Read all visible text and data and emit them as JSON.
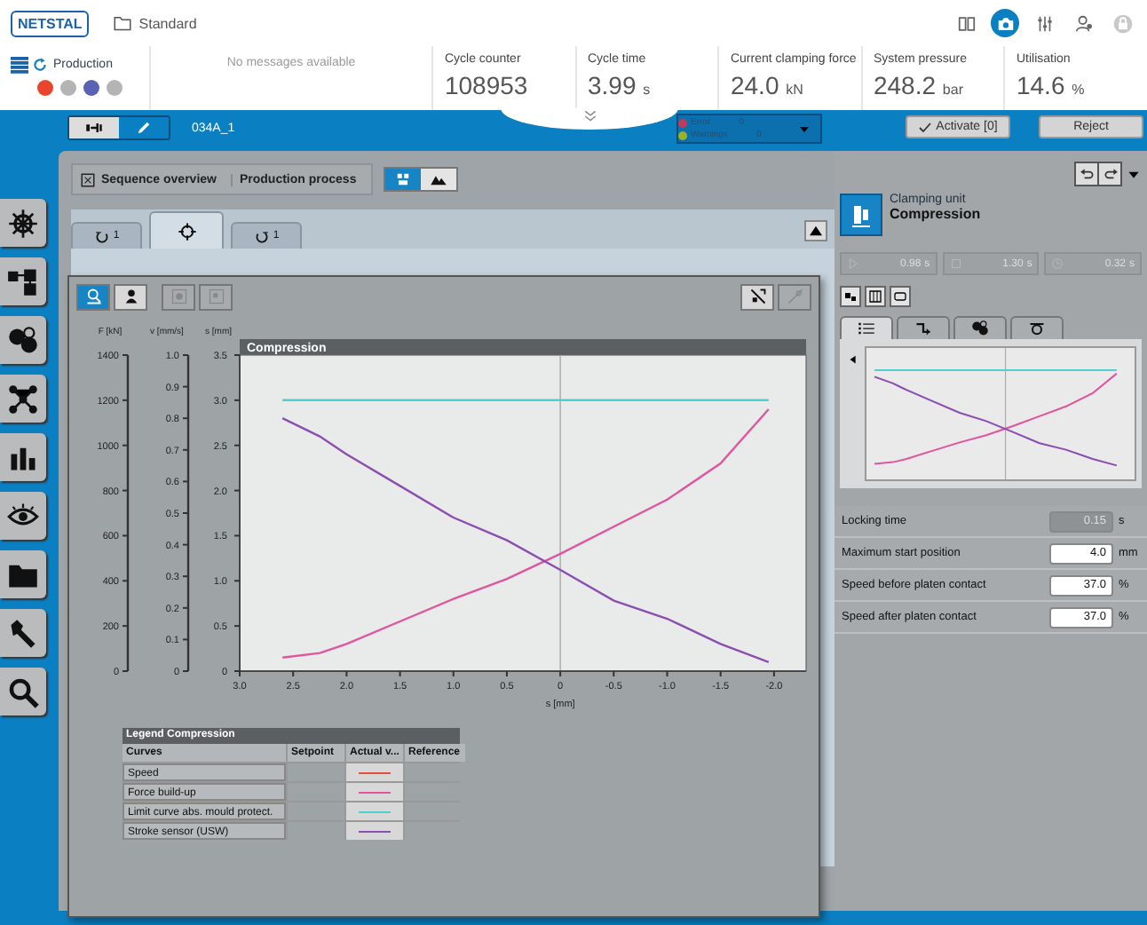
{
  "header": {
    "logo": "NETSTAL",
    "profile": "Standard",
    "top_icons": [
      {
        "kind": "book",
        "selected": false
      },
      {
        "kind": "camera",
        "selected": true
      },
      {
        "kind": "sliders",
        "selected": false
      },
      {
        "kind": "user",
        "selected": false
      },
      {
        "kind": "lock",
        "selected": false
      }
    ],
    "mode": "Production",
    "status_dots": [
      {
        "color": "#e8452c"
      },
      {
        "color": "#b4b4b4"
      },
      {
        "color": "#5a62b4"
      },
      {
        "color": "#b4b4b4"
      }
    ],
    "messages": "No messages available",
    "metrics": [
      {
        "label": "Cycle counter",
        "value": "108953"
      },
      {
        "label": "Cycle time",
        "value": "3.99",
        "unit": "s"
      },
      {
        "label": "Current clamping force",
        "value": "24.0",
        "unit": "kN"
      },
      {
        "label": "System pressure",
        "value": "248.2",
        "unit": "bar"
      },
      {
        "label": "Utilisation",
        "value": "14.6",
        "unit": "%"
      }
    ]
  },
  "toolbar": {
    "mode_toggle": [
      {
        "kind": "machine",
        "selected": false
      },
      {
        "kind": "pen",
        "selected": true
      }
    ],
    "program": "034A_1",
    "alarms": [
      {
        "kind": "error",
        "label": "Error",
        "count": "0"
      },
      {
        "kind": "warning",
        "label": "Warnings",
        "count": "0"
      }
    ],
    "buttons": [
      {
        "kind": "activate",
        "label": "Activate [0]"
      },
      {
        "kind": "reject",
        "label": "Reject"
      }
    ]
  },
  "sidebar": {
    "items": [
      {
        "kind": "wheel"
      },
      {
        "kind": "squares"
      },
      {
        "kind": "circles"
      },
      {
        "kind": "network"
      },
      {
        "kind": "bars"
      },
      {
        "kind": "eye"
      },
      {
        "kind": "folder"
      },
      {
        "kind": "wrench"
      },
      {
        "kind": "search"
      }
    ]
  },
  "main": {
    "breadcrumb": [
      "Sequence overview",
      "Production process"
    ],
    "view_toggle": [
      {
        "kind": "mold",
        "selected": true
      },
      {
        "kind": "mountains",
        "selected": false
      }
    ],
    "tabs": [
      {
        "kind": "rotate-left",
        "count": "1",
        "selected": false
      },
      {
        "kind": "target",
        "selected": true
      },
      {
        "kind": "rotate-right",
        "count": "1",
        "selected": false
      }
    ]
  },
  "chart_window": {
    "tools": [
      {
        "kind": "zoom",
        "selected": true,
        "disabled": false
      },
      {
        "kind": "person",
        "selected": false,
        "disabled": false
      },
      {
        "kind": "copy",
        "selected": false,
        "disabled": true
      },
      {
        "kind": "paste",
        "selected": false,
        "disabled": true
      }
    ],
    "right_tools": [
      {
        "kind": "cursor",
        "disabled": false
      },
      {
        "kind": "eraser",
        "disabled": true
      }
    ],
    "extra_axes": [
      {
        "label": "F [kN]",
        "ticks": [
          "1400",
          "1200",
          "1000",
          "800",
          "600",
          "400",
          "200",
          "0"
        ]
      },
      {
        "label": "v [mm/s]",
        "ticks": [
          "1.0",
          "0.9",
          "0.8",
          "0.7",
          "0.6",
          "0.5",
          "0.4",
          "0.3",
          "0.2",
          "0.1",
          "0"
        ]
      }
    ],
    "chart_data": {
      "type": "line",
      "title": "Compression",
      "xlabel": "s [mm]",
      "ylabel": "s [mm]",
      "x": [
        2.6,
        2.25,
        2.0,
        1.5,
        1.0,
        0.5,
        0.0,
        -0.5,
        -1.0,
        -1.5,
        -1.95
      ],
      "series": [
        {
          "name": "Speed",
          "color": "#e8503c",
          "values": [
            null,
            null,
            null,
            null,
            null,
            null,
            null,
            null,
            null,
            null,
            null
          ]
        },
        {
          "name": "Force build-up",
          "color": "#e0559f",
          "values": [
            0.15,
            0.2,
            0.3,
            0.55,
            0.8,
            1.02,
            1.3,
            1.6,
            1.9,
            2.3,
            2.9
          ]
        },
        {
          "name": "Limit curve abs. mould protect.",
          "color": "#4fcfcf",
          "values": [
            3.0,
            3.0,
            3.0,
            3.0,
            3.0,
            3.0,
            3.0,
            3.0,
            3.0,
            3.0,
            3.0
          ]
        },
        {
          "name": "Stroke sensor (USW)",
          "color": "#8a4fb0",
          "values": [
            2.8,
            2.6,
            2.4,
            2.05,
            1.7,
            1.45,
            1.12,
            0.78,
            0.58,
            0.3,
            0.1
          ]
        }
      ],
      "xlim": [
        3.0,
        -2.3
      ],
      "ylim": [
        0,
        3.5
      ],
      "xticks": [
        {
          "value": 3,
          "label": "3.0"
        },
        {
          "value": 2.5,
          "label": "2.5"
        },
        {
          "value": 2,
          "label": "2.0"
        },
        {
          "value": 1.5,
          "label": "1.5"
        },
        {
          "value": 1,
          "label": "1.0"
        },
        {
          "value": 0.5,
          "label": "0.5"
        },
        {
          "value": 0,
          "label": "0"
        },
        {
          "value": -0.5,
          "label": "-0.5"
        },
        {
          "value": -1,
          "label": "-1.0"
        },
        {
          "value": -1.5,
          "label": "-1.5"
        },
        {
          "value": -2,
          "label": "-2.0"
        }
      ],
      "yticks": [
        {
          "value": 0,
          "label": "0"
        },
        {
          "value": 0.5,
          "label": "0.5"
        },
        {
          "value": 1,
          "label": "1.0"
        },
        {
          "value": 1.5,
          "label": "1.5"
        },
        {
          "value": 2,
          "label": "2.0"
        },
        {
          "value": 2.5,
          "label": "2.5"
        },
        {
          "value": 3,
          "label": "3.0"
        },
        {
          "value": 3.5,
          "label": "3.5"
        }
      ]
    },
    "legend": {
      "title": "Legend Compression",
      "columns": [
        "Curves",
        "Setpoint",
        "Actual v...",
        "Reference"
      ]
    }
  },
  "right_panel": {
    "category": "Clamping unit",
    "name": "Compression",
    "times": [
      {
        "kind": "start",
        "value": "0.98",
        "unit": "s"
      },
      {
        "kind": "stop",
        "value": "1.30",
        "unit": "s"
      },
      {
        "kind": "clock",
        "value": "0.32",
        "unit": "s"
      }
    ],
    "tabs": [
      {
        "kind": "list",
        "selected": true
      },
      {
        "kind": "step",
        "selected": false
      },
      {
        "kind": "circles",
        "selected": false
      },
      {
        "kind": "valve",
        "selected": false
      }
    ],
    "parameters": [
      {
        "label": "Locking time",
        "value": "0.15",
        "unit": "s",
        "disabled": true
      },
      {
        "label": "Maximum start position",
        "value": "4.0",
        "unit": "mm",
        "disabled": false
      },
      {
        "label": "Speed before platen contact",
        "value": "37.0",
        "unit": "%",
        "disabled": false
      },
      {
        "label": "Speed after platen contact",
        "value": "37.0",
        "unit": "%",
        "disabled": false
      }
    ]
  }
}
